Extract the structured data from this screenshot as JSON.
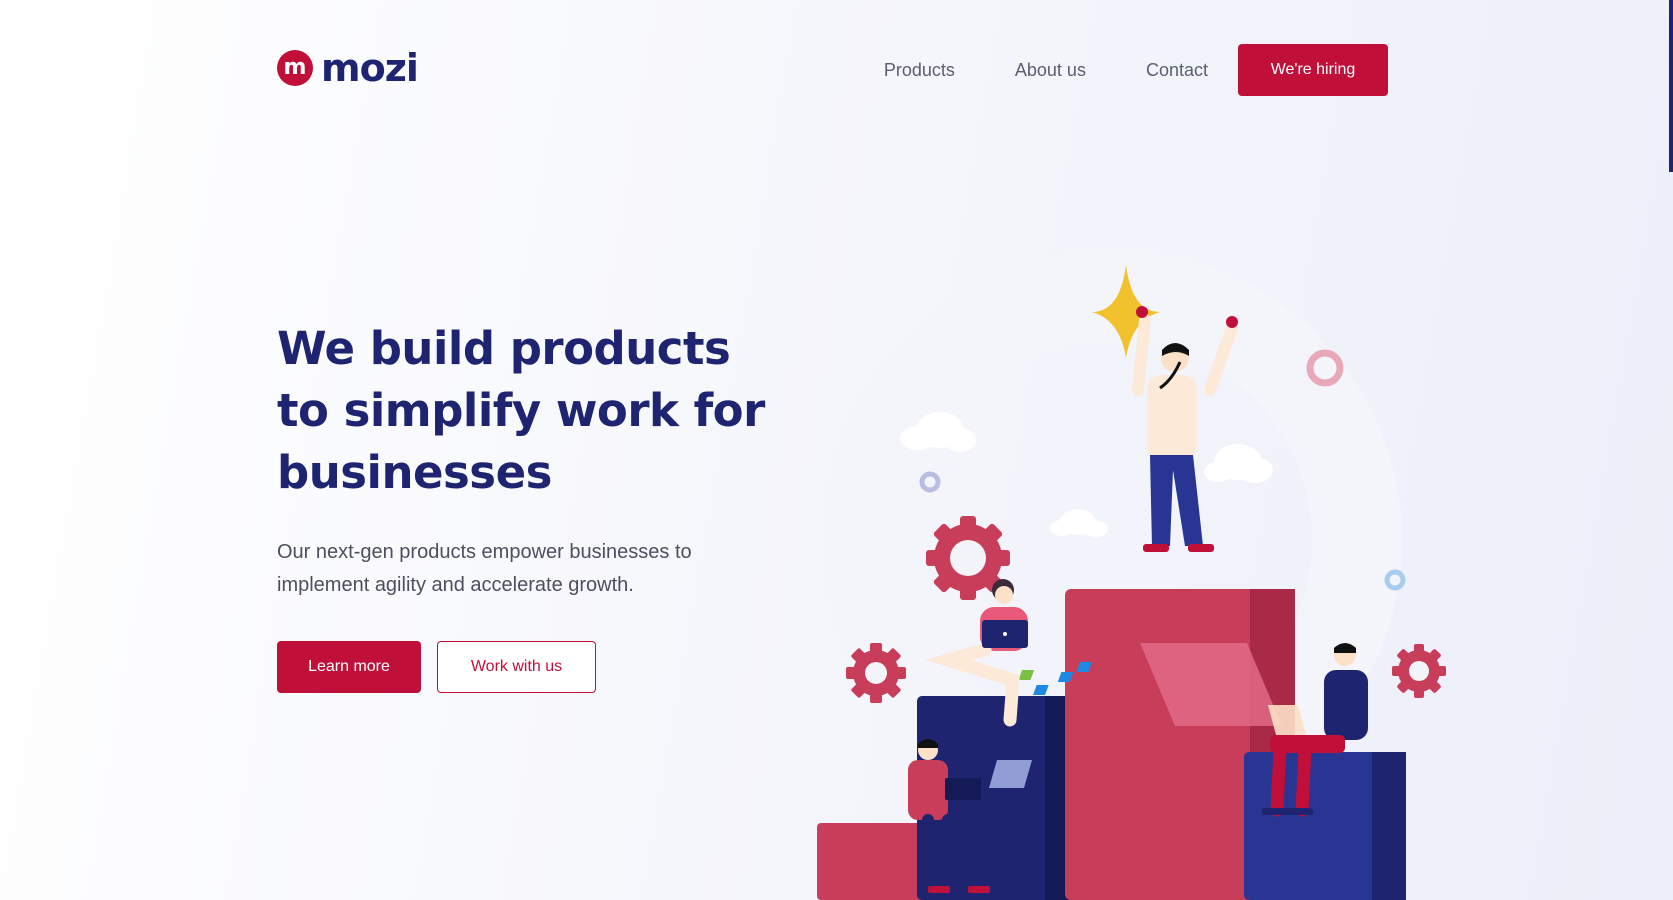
{
  "brand": {
    "logo_mark": "m",
    "name": "mozi"
  },
  "nav": {
    "items": [
      "Products",
      "About us",
      "Contact"
    ],
    "cta_label": "We're hiring"
  },
  "hero": {
    "title": "We build products to simplify work for businesses",
    "subtitle": "Our next-gen products empower businesses to implement agility and accelerate growth.",
    "primary_button": "Learn more",
    "secondary_button": "Work with us"
  },
  "colors": {
    "accent": "#c0103a",
    "navy": "#1e2470",
    "illustration_red": "#c73d5a",
    "illustration_blue": "#283593",
    "star": "#f2c12e"
  }
}
